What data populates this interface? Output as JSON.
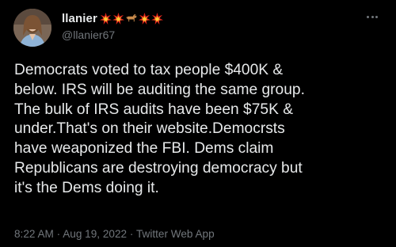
{
  "tweet": {
    "display_name": "llanier",
    "name_emojis": [
      "collision-emoji",
      "collision-emoji",
      "dog-emoji",
      "collision-emoji",
      "collision-emoji"
    ],
    "handle": "@llanier67",
    "text": "Democrats voted to tax people $400K &\nbelow. IRS will be auditing the same group.\nThe bulk of IRS audits have been $75K &\nunder.That's on their website.Democrsts\nhave weaponized the FBI. Dems claim\nRepublicans are destroying democracy but\nit's the Dems doing it.",
    "time": "8:22 AM",
    "separator": "·",
    "date": "Aug 19, 2022",
    "source": "Twitter Web App"
  },
  "colors": {
    "background": "#000000",
    "primary_text": "#e7e9ea",
    "secondary_text": "#71767b",
    "emoji_red": "#e0241b",
    "emoji_yellow": "#ffcc33"
  }
}
